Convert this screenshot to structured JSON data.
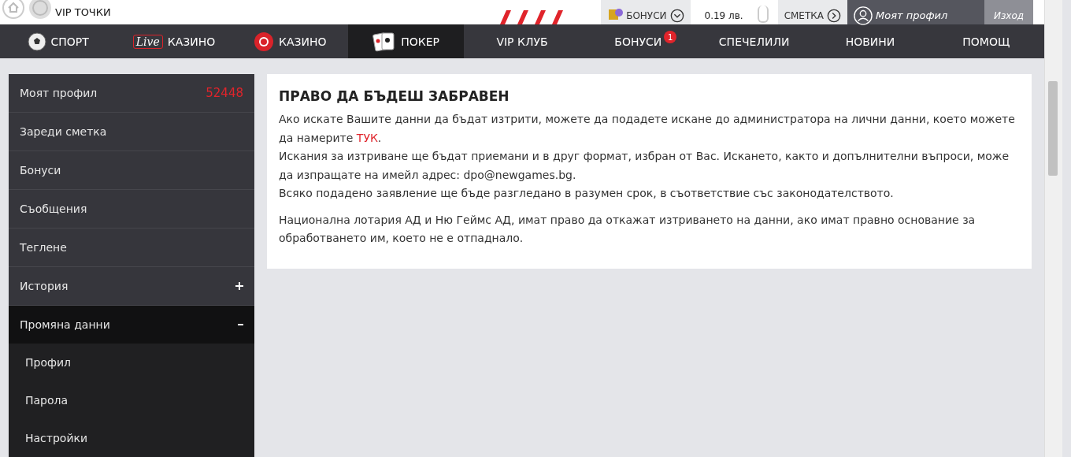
{
  "top_bar": {
    "vip_points": "VIP ТОЧКИ",
    "bonuses": "БОНУСИ",
    "balance": "0.19 лв.",
    "account": "СМЕТКА",
    "profile": "Моят профил",
    "logout": "Изход"
  },
  "nav": [
    {
      "label": "СПОРТ",
      "kind": "ball",
      "selected": false
    },
    {
      "label": "КАЗИНО",
      "kind": "live",
      "live": "Live",
      "selected": false
    },
    {
      "label": "КАЗИНО",
      "kind": "chip",
      "selected": false
    },
    {
      "label": "ПОКЕР",
      "kind": "cards",
      "selected": true
    },
    {
      "label": "VIP КЛУБ",
      "selected": false
    },
    {
      "label": "БОНУСИ",
      "badge": "1",
      "selected": false
    },
    {
      "label": "СПЕЧЕЛИЛИ",
      "selected": false
    },
    {
      "label": "НОВИНИ",
      "selected": false
    },
    {
      "label": "ПОМОЩ",
      "selected": false
    }
  ],
  "sidebar": {
    "items": [
      {
        "label": "Моят профил",
        "count": "52448",
        "selected": false
      },
      {
        "label": "Зареди сметка",
        "selected": false
      },
      {
        "label": "Бонуси",
        "selected": false
      },
      {
        "label": "Съобщения",
        "selected": false
      },
      {
        "label": "Теглене",
        "selected": false
      },
      {
        "label": "История",
        "expanded": false,
        "selected": false
      },
      {
        "label": "Промяна данни",
        "expanded": true,
        "selected": true,
        "children": [
          {
            "label": "Профил"
          },
          {
            "label": "Парола"
          },
          {
            "label": "Настройки"
          }
        ]
      }
    ]
  },
  "article": {
    "title": "ПРАВО ДА БЪДЕШ ЗАБРАВЕН",
    "paragraphs": [
      {
        "lines": [
          {
            "text": "Ако искате Вашите данни да бъдат изтрити, можете да подадете искане до администратора на лични данни, което можете да намерите ",
            "link": "ТУК",
            "after": "."
          },
          {
            "text": "Искания за изтриване ще бъдат приемани и в друг формат, избран от Вас. Искането, както и допълнителни въпроси, може да изпращате на имейл адрес: dpo@newgames.bg."
          },
          {
            "text": "Всяко подадено заявление ще бъде разгледано в разумен срок, в съответствие със законодателството."
          }
        ]
      },
      {
        "lines": [
          {
            "text": "Национална лотария АД и Ню Геймс АД, имат право да откажат изтриването на данни, ако имат правно основание за обработването им, което не е отпаднало."
          }
        ]
      }
    ]
  }
}
